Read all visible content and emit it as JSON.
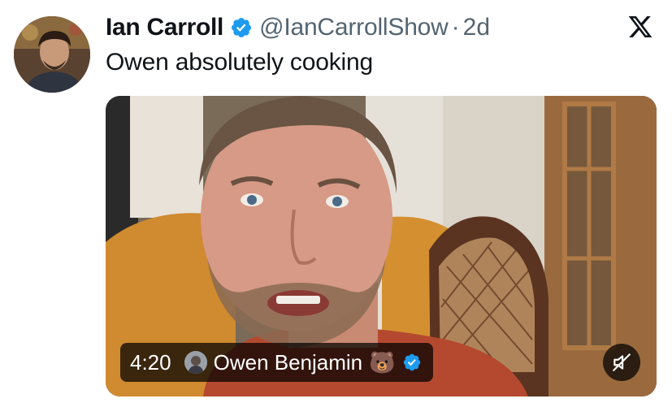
{
  "tweet": {
    "author": {
      "display_name": "Ian Carroll",
      "handle": "@IanCarrollShow",
      "verified": true
    },
    "separator": "·",
    "time_ago": "2d",
    "text": "Owen absolutely cooking"
  },
  "video": {
    "duration": "4:20",
    "embedded_author": {
      "name": "Owen Benjamin",
      "emoji": "🐻",
      "verified": true
    },
    "muted": true
  },
  "icons": {
    "brand": "x-logo-icon",
    "verified": "verified-badge-icon",
    "mute": "muted-speaker-icon"
  },
  "colors": {
    "text_primary": "#0f1419",
    "text_secondary": "#536471",
    "verified_blue": "#1d9bf0",
    "overlay_bg": "rgba(0,0,0,0.72)"
  }
}
